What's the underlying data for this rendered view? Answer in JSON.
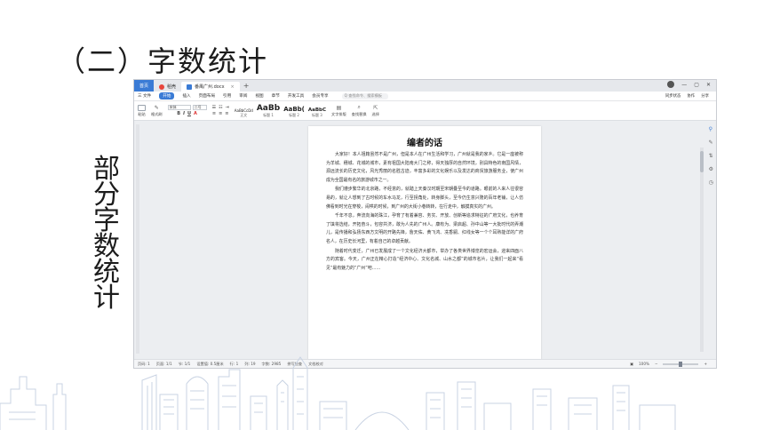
{
  "slide": {
    "title": "（二）字数统计",
    "vertical_label": [
      "部",
      "分",
      "字",
      "数",
      "统",
      "计"
    ]
  },
  "window": {
    "tabs": {
      "home": "首页",
      "tab1": "稻壳",
      "tab2": "番禺广州.docx",
      "close": "×",
      "add": "+"
    },
    "menu": {
      "items": [
        "三 文件",
        "开始",
        "插入",
        "页面布局",
        "引用",
        "审阅",
        "视图",
        "章节",
        "开发工具",
        "会员专享"
      ],
      "active_index": 1,
      "search": "Q 查找命令、搜索模板",
      "right": [
        "同步状态",
        "协作",
        "分享"
      ]
    },
    "ribbon": {
      "paste": "粘贴",
      "format_painter": "格式刷",
      "font_name": "宋体",
      "font_size": "二号",
      "styles": [
        {
          "sample": "AaBbCcDd",
          "label": "正文"
        },
        {
          "sample": "AaBb",
          "label": "标题 1"
        },
        {
          "sample": "AaBb(",
          "label": "标题 2"
        },
        {
          "sample": "AaBbC",
          "label": "标题 3"
        }
      ],
      "text_tools": "文字排版",
      "find_replace": "查找替换",
      "select": "选择"
    },
    "document": {
      "title": "编者的话",
      "paragraphs": [
        "大家好！本人祖籍虽然不是广州，但是本人在广州生活和学习，广州就是我的家乡。它是一座被称为羊城、穗城、花城的城市，素有祖国大陆南大门之称，得天独厚的自然环境，别具特色的南国风情，源远流长的历史文化，风光秀丽的名胜古迹，丰富多彩的文化娱乐以及发达的商贸旅游服务业，使广州成为全国最有名的旅游城市之一。",
        "我们遵步繁华的北京路，不经意的，就踏上天秦汉时期至宋朝叠至今的道路。眼前的人来人往很容易的，就让人想到了古时候的车水马龙，行至拐角处，转身脚头，至今仍生意兴隆的百年老铺，让人仿佛看到时光在穿梭，闹哄的时候，到广州的大街小巷转转，在行走中，触摸真实的广州。",
        "千年不息，奔流向海的珠江，孕育了有着兼容、务实、开放、创新等追求特征的广府文化，也养育了填将选结，开拓奋斗，包容共济，敢为人先的广州人。康有为、梁启超、孙中山等一大批时代的弄潮儿，是传播和弘扬东西方文明的开路先锋，詹天佑、黄飞鸿、冼香嗣、红线女等一个个耳熟能详的广府名人，在历史长河里，有着自己的卓越贡献。",
        "随着时代变迁，广州已发展成了一个文化经济大都市，举办了各类世界博览的宏运会，迎来四面八方的宾客。今天，广州正在精心打造“经济中心、文化名城、山水之都”的城市名片，让我们一起来“看见“最有魅力的”广州”吧……"
      ]
    },
    "status": {
      "items": [
        "页码: 1",
        "页面: 1/1",
        "节: 1/1",
        "设置值: 0.5厘米",
        "行: 1",
        "列: 19",
        "字数: 2985",
        "拼写检查",
        "文档校对"
      ],
      "zoom": "100%"
    }
  },
  "colors": {
    "accent": "#3a7bd5",
    "skyline": "#c9d3e3"
  }
}
